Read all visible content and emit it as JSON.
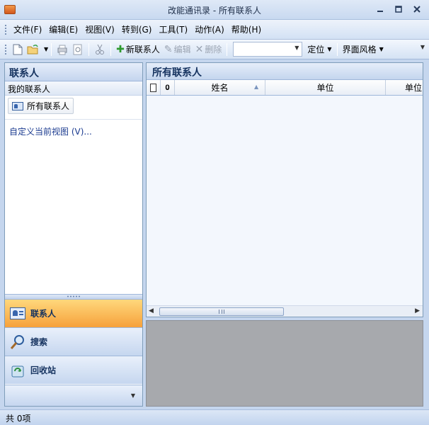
{
  "window": {
    "title": "改能通讯录 - 所有联系人",
    "controls": [
      "minimize",
      "maximize",
      "close"
    ]
  },
  "menu": [
    "文件(F)",
    "编辑(E)",
    "视图(V)",
    "转到(G)",
    "工具(T)",
    "动作(A)",
    "帮助(H)"
  ],
  "toolbar": {
    "new_contact": "新联系人",
    "edit": "编辑",
    "delete": "删除",
    "search_value": "",
    "locate": "定位",
    "theme": "界面风格"
  },
  "nav": {
    "header": "联系人",
    "group": "我的联系人",
    "folder_all": "所有联系人",
    "customize": "自定义当前视图 (V)...",
    "buttons": [
      {
        "label": "联系人",
        "icon": "contact-card-icon",
        "active": true
      },
      {
        "label": "搜索",
        "icon": "search-icon",
        "active": false
      },
      {
        "label": "回收站",
        "icon": "recycle-bin-icon",
        "active": false
      }
    ]
  },
  "main": {
    "header": "所有联系人",
    "columns": [
      "姓名",
      "单位",
      "单位"
    ]
  },
  "status": {
    "count_text": "共 0项"
  },
  "colors": {
    "active_nav": "#f6a13b",
    "frame": "#c5d6ee",
    "preview_bg": "#a7a9ad"
  }
}
